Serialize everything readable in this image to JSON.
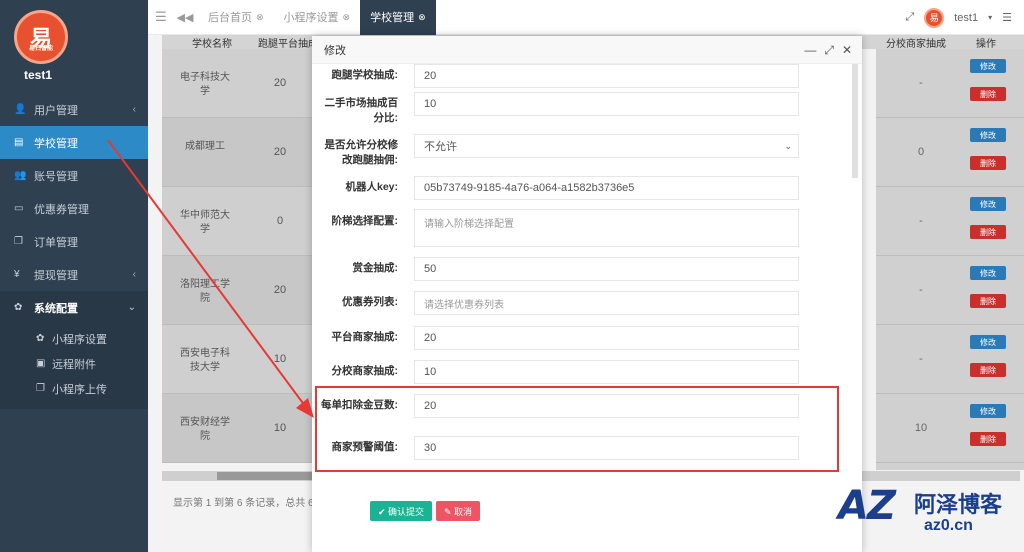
{
  "profile": {
    "name": "test1",
    "logo_text": "易",
    "logo_sub": "易扫智能"
  },
  "sidebar": {
    "items": [
      {
        "icon": "user-icon",
        "glyph": "👤",
        "label": "用户管理",
        "arrow": "‹"
      },
      {
        "icon": "book-icon",
        "glyph": "▤",
        "label": "学校管理",
        "arrow": ""
      },
      {
        "icon": "users-icon",
        "glyph": "👥",
        "label": "账号管理",
        "arrow": ""
      },
      {
        "icon": "coupon-icon",
        "glyph": "▭",
        "label": "优惠券管理",
        "arrow": ""
      },
      {
        "icon": "order-icon",
        "glyph": "❐",
        "label": "订单管理",
        "arrow": ""
      },
      {
        "icon": "yen-icon",
        "glyph": "¥",
        "label": "提现管理",
        "arrow": "‹"
      },
      {
        "icon": "gear-icon",
        "glyph": "✿",
        "label": "系统配置",
        "arrow": "⌄"
      }
    ],
    "sub_items": [
      {
        "icon": "gear-icon",
        "glyph": "✿",
        "label": "小程序设置"
      },
      {
        "icon": "image-icon",
        "glyph": "▣",
        "label": "远程附件"
      },
      {
        "icon": "copy-icon",
        "glyph": "❐",
        "label": "小程序上传"
      }
    ]
  },
  "topbar": {
    "tabs": [
      {
        "label": "后台首页",
        "active": false
      },
      {
        "label": "小程序设置",
        "active": false
      },
      {
        "label": "学校管理",
        "active": true
      }
    ],
    "user": "test1"
  },
  "table": {
    "headers": [
      "学校名称",
      "跑腿平台抽成",
      "分校商家抽成",
      "操作"
    ],
    "rows": [
      {
        "name": "电子科技大学",
        "v1": "20",
        "v2": "-"
      },
      {
        "name": "成都理工",
        "v1": "20",
        "v2": "0"
      },
      {
        "name": "华中师范大学",
        "v1": "0",
        "v2": "-"
      },
      {
        "name": "洛阳理工学院",
        "v1": "20",
        "v2": "-"
      },
      {
        "name": "西安电子科技大学",
        "v1": "10",
        "v2": "-"
      },
      {
        "name": "西安财经学院",
        "v1": "10",
        "v2": "10"
      }
    ],
    "edit_label": "修改",
    "delete_label": "删除",
    "footer": "显示第 1 到第 6 条记录，总共 6"
  },
  "modal": {
    "title": "修改",
    "fields": [
      {
        "label": "跑腿学校抽成:",
        "value": "20",
        "type": "input"
      },
      {
        "label": "二手市场抽成百分比:",
        "value": "10",
        "type": "input"
      },
      {
        "label": "是否允许分校修改跑腿抽佣:",
        "value": "不允许",
        "type": "select"
      },
      {
        "label": "机器人key:",
        "value": "05b73749-9185-4a76-a064-a1582b3736e5",
        "type": "input"
      },
      {
        "label": "阶梯选择配置:",
        "placeholder": "请输入阶梯选择配置",
        "type": "textarea"
      },
      {
        "label": "赏金抽成:",
        "value": "50",
        "type": "input"
      },
      {
        "label": "优惠券列表:",
        "placeholder": "请选择优惠券列表",
        "type": "input"
      },
      {
        "label": "平台商家抽成:",
        "value": "20",
        "type": "input"
      },
      {
        "label": "分校商家抽成:",
        "value": "10",
        "type": "input"
      },
      {
        "label": "每单扣除金豆数:",
        "value": "20",
        "type": "input"
      },
      {
        "label": "商家预警阈值:",
        "value": "30",
        "type": "input"
      }
    ],
    "submit_label": "✔ 确认提交",
    "cancel_label": "✎ 取消"
  },
  "watermark": {
    "logo": "AZ",
    "name": "阿泽博客",
    "url": "az0.cn"
  },
  "colors": {
    "sidebar": "#2f4050",
    "active": "#2c8ac7",
    "submit": "#1ab394",
    "cancel": "#ed5565",
    "highlight": "#e53935"
  }
}
